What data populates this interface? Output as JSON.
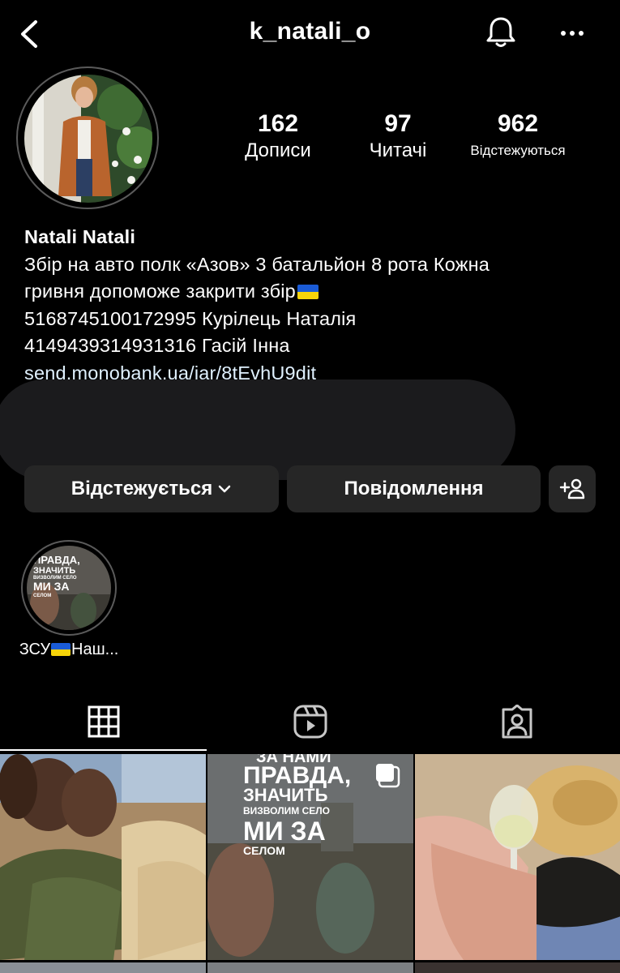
{
  "header": {
    "username": "k_natali_o",
    "back_icon": "chevron-left-icon",
    "bell_icon": "bell-icon",
    "more_icon": "more-horizontal-icon"
  },
  "stats": {
    "posts": {
      "value": "162",
      "label": "Дописи"
    },
    "followers": {
      "value": "97",
      "label": "Читачі"
    },
    "following": {
      "value": "962",
      "label": "Відстежуються"
    }
  },
  "bio": {
    "name": "Natali Natali",
    "line1": "Збір на авто полк «Азов» 3 батальйон 8 рота Кожна",
    "line2": "гривня допоможе закрити збір",
    "line3": "5168745100172995 Курілець Наталія",
    "line4": "4149439314931316 Гасій Інна",
    "link": "send.monobank.ua/jar/8tEvhU9dit"
  },
  "actions": {
    "following_label": "Відстежується",
    "message_label": "Повідомлення",
    "add_icon": "add-person-icon"
  },
  "highlights": [
    {
      "label": "ЗСУ",
      "label_suffix": "Наш...",
      "overlay_line1": "ПРАВДА,",
      "overlay_line2": "ЗНАЧИТЬ",
      "overlay_line3": "ВИЗВОЛИМ СЕЛО",
      "overlay_line4": "МИ ЗА",
      "overlay_line5": "СЕЛОМ"
    }
  ],
  "tabs": {
    "grid_icon": "grid-icon",
    "reels_icon": "reels-icon",
    "tagged_icon": "tagged-icon"
  },
  "grid": {
    "post2": {
      "line0": "ЗА НАМИ",
      "line1": "ПРАВДА,",
      "line2": "ЗНАЧИТЬ",
      "line3": "ВИЗВОЛИМ СЕЛО",
      "line4": "МИ ЗА",
      "line5": "СЕЛОМ"
    }
  },
  "colors": {
    "background": "#000000",
    "button": "#262626",
    "link": "#e0f1ff",
    "flag_blue": "#1a5bd6",
    "flag_yellow": "#f6d40a"
  }
}
